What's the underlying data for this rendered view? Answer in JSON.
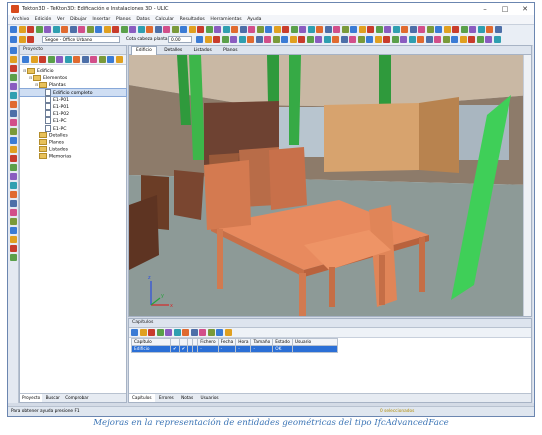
{
  "window": {
    "title": "Tekton3D - TeKton3D: Edificación e Instalaciones 3D - ULIC",
    "controls": [
      "–",
      "□",
      "✕"
    ]
  },
  "menu": [
    "Archivo",
    "Edición",
    "Ver",
    "Dibujar",
    "Insertar",
    "Planos",
    "Datos",
    "Calcular",
    "Resultados",
    "Herramientas",
    "Ayuda"
  ],
  "toolbar": {
    "style_combo": "Segoe - Office Urbano",
    "elevation_label": "Cota cabeza planta:",
    "elevation_value": "0.00",
    "icon_colors": [
      "#3a7bd5",
      "#e0a020",
      "#c83c2c",
      "#5aa04a",
      "#8a5cc0",
      "#2f9fb0",
      "#e06a30",
      "#4d6fa8",
      "#d24f8a",
      "#7a9a3a"
    ]
  },
  "project": {
    "header": "Proyecto",
    "tree": [
      {
        "label": "Edificio",
        "level": 0,
        "type": "root",
        "expander": "⊟"
      },
      {
        "label": "Elementos",
        "level": 1,
        "type": "folder",
        "expander": "⊟"
      },
      {
        "label": "Plantas",
        "level": 2,
        "type": "folder",
        "expander": "⊟"
      },
      {
        "label": "Edificio completo",
        "level": 3,
        "type": "doc",
        "selected": true
      },
      {
        "label": "E1-P01",
        "level": 3,
        "type": "doc"
      },
      {
        "label": "E1-P01",
        "level": 3,
        "type": "doc"
      },
      {
        "label": "E1-P02",
        "level": 3,
        "type": "doc"
      },
      {
        "label": "E1-PC",
        "level": 3,
        "type": "doc"
      },
      {
        "label": "E1-PC",
        "level": 3,
        "type": "doc"
      },
      {
        "label": "Detalles",
        "level": 2,
        "type": "folder"
      },
      {
        "label": "Planos",
        "level": 2,
        "type": "folder"
      },
      {
        "label": "Listados",
        "level": 2,
        "type": "folder"
      },
      {
        "label": "Memorias",
        "level": 2,
        "type": "folder"
      }
    ],
    "tabs": [
      "Proyecto",
      "Buscar",
      "Comprobar"
    ]
  },
  "view": {
    "tabs": [
      "Edificio",
      "Detalles",
      "Listados",
      "Planos"
    ],
    "active_tab": "Edificio",
    "axis_labels": {
      "z": "z",
      "x": "x",
      "y": "y"
    }
  },
  "capitulos": {
    "header": "Capítulos",
    "columns": [
      "Capítulo",
      "",
      "",
      "",
      "",
      "Fichero",
      "Fecha",
      "Hora",
      "Tamaño",
      "Estado",
      "Usuario"
    ],
    "rows": [
      {
        "name": "Edificio",
        "c1": "✔",
        "c2": "✔",
        "c3": "",
        "c4": "",
        "fichero": "-",
        "fecha": "-",
        "hora": "-",
        "tamano": "-",
        "estado": "OK",
        "usuario": ""
      }
    ],
    "tabs": [
      "Capítulos",
      "Errores",
      "Notas",
      "Usuarios"
    ]
  },
  "status": {
    "help": "Para obtener ayuda presione F1",
    "selection": "0 seleccionados"
  },
  "caption": "Mejoras en la representación de entidades geométricas del tipo IfcAdvancedFace"
}
